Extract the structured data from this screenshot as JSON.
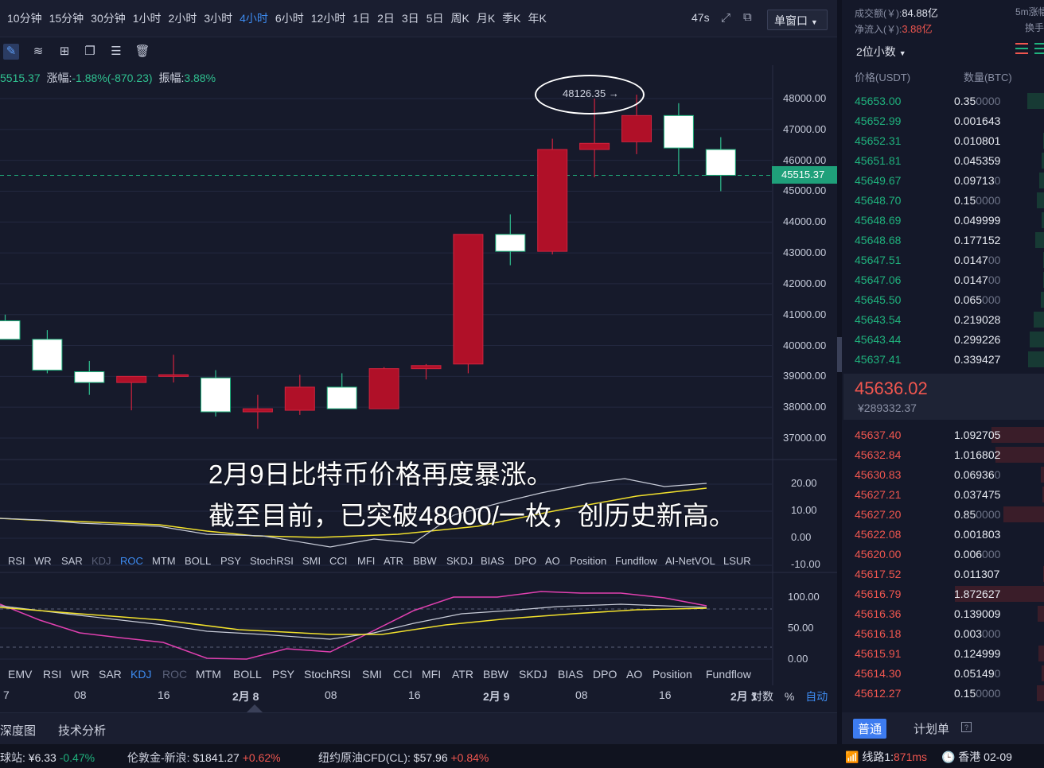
{
  "timeframes": [
    "10分钟",
    "15分钟",
    "30分钟",
    "1小时",
    "2小时",
    "3小时",
    "4小时",
    "6小时",
    "12小时",
    "1日",
    "2日",
    "3日",
    "5日",
    "周K",
    "月K",
    "季K",
    "年K"
  ],
  "active_timeframe": "4小时",
  "latency": "47s",
  "window_mode": "单窗口",
  "info_line": {
    "close": "5515.37",
    "change_label": "涨幅:",
    "change": "-1.88%(-870.23)",
    "amplitude_label": "振幅:",
    "amplitude": "3.88%"
  },
  "price_axis": [
    "48000.00",
    "47000.00",
    "46000.00",
    "45000.00",
    "44000.00",
    "43000.00",
    "42000.00",
    "41000.00",
    "40000.00",
    "39000.00",
    "38000.00",
    "37000.00"
  ],
  "current_price_tag": "45515.37",
  "high_marker": "48126.35",
  "mid_axis": [
    "20.00",
    "10.00",
    "0.00",
    "-10.00"
  ],
  "low_axis": [
    "100.00",
    "50.00",
    "0.00"
  ],
  "indicator_tabs_1": [
    "RSI",
    "WR",
    "SAR",
    "KDJ",
    "ROC",
    "MTM",
    "BOLL",
    "PSY",
    "StochRSI",
    "SMI",
    "CCI",
    "MFI",
    "ATR",
    "BBW",
    "SKDJ",
    "BIAS",
    "DPO",
    "AO",
    "Position",
    "Fundflow",
    "AI-NetVOL",
    "LSUR"
  ],
  "indicator_tabs_1_active": "ROC",
  "indicator_tabs_2": [
    "EMV",
    "RSI",
    "WR",
    "SAR",
    "KDJ",
    "ROC",
    "MTM",
    "BOLL",
    "PSY",
    "StochRSI",
    "SMI",
    "CCI",
    "MFI",
    "ATR",
    "BBW",
    "SKDJ",
    "BIAS",
    "DPO",
    "AO",
    "Position",
    "Fundflow"
  ],
  "indicator_tabs_2_active": "KDJ",
  "time_axis": [
    "7",
    "08",
    "16",
    "2月 8",
    "08",
    "16",
    "2月 9",
    "08",
    "16",
    "2月 1"
  ],
  "axis_controls": {
    "log": "对数",
    "percent": "%",
    "auto": "自动"
  },
  "bottom_tabs": [
    "深度图",
    "技术分析"
  ],
  "caption_line1": "2月9日比特币价格再度暴涨。",
  "caption_line2": "截至目前，已突破48000/一枚，创历史新高。",
  "right": {
    "turnover_label": "成交额(￥):",
    "turnover": "84.88亿",
    "inflow_label": "净流入(￥):",
    "inflow": "3.88亿",
    "period": "5m涨幅",
    "turnover_rate": "换手",
    "decimals": "2位小数",
    "col_price": "价格(USDT)",
    "col_qty": "数量(BTC)",
    "asks": [
      [
        "45653.00",
        "0.35",
        "0000"
      ],
      [
        "45652.99",
        "0.001643",
        ""
      ],
      [
        "45652.31",
        "0.010801",
        ""
      ],
      [
        "45651.81",
        "0.045359",
        ""
      ],
      [
        "45649.67",
        "0.09713",
        "0"
      ],
      [
        "45648.70",
        "0.15",
        "0000"
      ],
      [
        "45648.69",
        "0.049999",
        ""
      ],
      [
        "45648.68",
        "0.177152",
        ""
      ],
      [
        "45647.51",
        "0.0147",
        "00"
      ],
      [
        "45647.06",
        "0.0147",
        "00"
      ],
      [
        "45645.50",
        "0.065",
        "000"
      ],
      [
        "45643.54",
        "0.219028",
        ""
      ],
      [
        "45643.44",
        "0.299226",
        ""
      ],
      [
        "45637.41",
        "0.339427",
        ""
      ]
    ],
    "last_price": "45636.02",
    "last_cny": "¥289332.37",
    "bids": [
      [
        "45637.40",
        "1.092705",
        ""
      ],
      [
        "45632.84",
        "1.016802",
        ""
      ],
      [
        "45630.83",
        "0.06936",
        "0"
      ],
      [
        "45627.21",
        "0.037475",
        ""
      ],
      [
        "45627.20",
        "0.85",
        "0000"
      ],
      [
        "45622.08",
        "0.001803",
        ""
      ],
      [
        "45620.00",
        "0.006",
        "000"
      ],
      [
        "45617.52",
        "0.011307",
        ""
      ],
      [
        "45616.79",
        "1.872627",
        ""
      ],
      [
        "45616.36",
        "0.139009",
        ""
      ],
      [
        "45616.18",
        "0.003",
        "000"
      ],
      [
        "45615.91",
        "0.124999",
        ""
      ],
      [
        "45614.30",
        "0.05149",
        "0"
      ],
      [
        "45612.27",
        "0.15",
        "0000"
      ]
    ],
    "order_type_active": "普通",
    "order_type_plan": "计划单"
  },
  "ticker": [
    {
      "name": "球站:",
      "price": "¥6.33",
      "chg": "-0.47%",
      "dir": "down"
    },
    {
      "name": "伦敦金-新浪:",
      "price": "$1841.27",
      "chg": "+0.62%",
      "dir": "up"
    },
    {
      "name": "纽约原油CFD(CL):",
      "price": "$57.96",
      "chg": "+0.84%",
      "dir": "up"
    }
  ],
  "status": {
    "line": "线路1:",
    "ms": "871ms",
    "region": "香港 02-09"
  },
  "chart_data": {
    "type": "candlestick",
    "interval": "4小时",
    "candles": [
      {
        "o": 40800,
        "h": 41000,
        "l": 40300,
        "c": 40200
      },
      {
        "o": 40200,
        "h": 40500,
        "l": 39100,
        "c": 39200
      },
      {
        "o": 39150,
        "h": 39500,
        "l": 38400,
        "c": 38800
      },
      {
        "o": 38800,
        "h": 39000,
        "l": 37900,
        "c": 39000
      },
      {
        "o": 39000,
        "h": 39700,
        "l": 38800,
        "c": 39050
      },
      {
        "o": 38950,
        "h": 39200,
        "l": 37700,
        "c": 37850
      },
      {
        "o": 37850,
        "h": 38400,
        "l": 37300,
        "c": 37950
      },
      {
        "o": 37900,
        "h": 39050,
        "l": 37750,
        "c": 38650
      },
      {
        "o": 38650,
        "h": 39100,
        "l": 37950,
        "c": 37950
      },
      {
        "o": 37950,
        "h": 39300,
        "l": 37950,
        "c": 39250
      },
      {
        "o": 39250,
        "h": 39400,
        "l": 38900,
        "c": 39350
      },
      {
        "o": 39400,
        "h": 42200,
        "l": 39100,
        "c": 43600
      },
      {
        "o": 43600,
        "h": 44250,
        "l": 42600,
        "c": 43050
      },
      {
        "o": 43050,
        "h": 46700,
        "l": 42950,
        "c": 46350
      },
      {
        "o": 46350,
        "h": 48000,
        "l": 45450,
        "c": 46550
      },
      {
        "o": 46600,
        "h": 48126.35,
        "l": 46200,
        "c": 47450
      },
      {
        "o": 47450,
        "h": 47850,
        "l": 45550,
        "c": 46400
      },
      {
        "o": 46350,
        "h": 46750,
        "l": 45000,
        "c": 45515.37
      }
    ],
    "ylim": [
      37000,
      48000
    ],
    "current_price": 45515.37
  }
}
